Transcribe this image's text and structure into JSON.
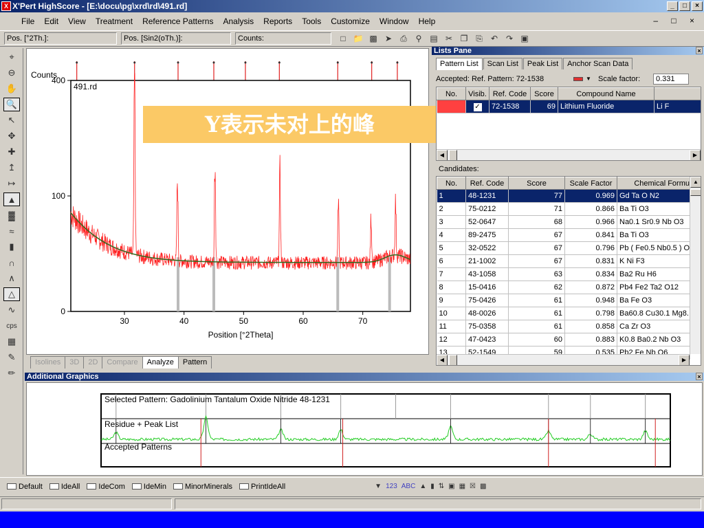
{
  "window": {
    "title": "X'Pert HighScore - [E:\\docu\\pg\\xrd\\rd\\491.rd]",
    "controls": [
      "_",
      "□",
      "×"
    ],
    "mdi_controls": "– □ ×"
  },
  "menu": [
    "File",
    "Edit",
    "View",
    "Treatment",
    "Reference Patterns",
    "Analysis",
    "Reports",
    "Tools",
    "Customize",
    "Window",
    "Help"
  ],
  "toolbar": {
    "pos_2th": "Pos. [°2Th.]:",
    "pos_sin": "Pos. [Sin2(oTh.)]:",
    "counts": "Counts:"
  },
  "plot": {
    "file_label": "491.rd",
    "ylabel": "Counts",
    "xlabel": "Position [°2Theta]",
    "overlay_text": "Y表示未对上的峰",
    "peak_markers_deg": [
      22,
      31.7,
      39,
      45,
      50.3,
      56,
      65.8,
      71.5,
      75.8
    ],
    "unmatched_bars_deg": [
      39,
      45,
      65.8,
      74.5
    ]
  },
  "chart_data": {
    "type": "line",
    "title": "491.rd",
    "xlabel": "Position [°2Theta]",
    "ylabel": "Counts",
    "xlim": [
      21,
      78
    ],
    "ylim": [
      0,
      400
    ],
    "y_scale": "sqrt",
    "xticks": [
      30,
      40,
      50,
      60,
      70
    ],
    "yticks": [
      0,
      100,
      400
    ],
    "series": [],
    "peaks": [
      {
        "x": 31.7,
        "y": 400
      },
      {
        "x": 38.9,
        "y": 130
      },
      {
        "x": 45.2,
        "y": 170
      },
      {
        "x": 56.1,
        "y": 145
      },
      {
        "x": 65.9,
        "y": 82
      },
      {
        "x": 71.4,
        "y": 70
      },
      {
        "x": 75.5,
        "y": 90
      }
    ]
  },
  "bottom_tabs": [
    "Isolines",
    "3D",
    "2D",
    "Compare",
    "Analyze",
    "Pattern"
  ],
  "lists_pane": {
    "title": "Lists Pane",
    "tabs": [
      "Pattern List",
      "Scan List",
      "Peak List",
      "Anchor Scan Data"
    ],
    "accepted_label": "Accepted: Ref. Pattern: 72-1538",
    "scale_label": "Scale factor:",
    "scale_value": "0.331",
    "accepted_headers": [
      "No.",
      "Visib.",
      "Ref. Code",
      "Score",
      "Compound Name",
      "Ch"
    ],
    "accepted_rows": [
      {
        "no": "",
        "ref": "72-1538",
        "score": "69",
        "name": "Lithium Fluoride",
        "ch": "Li F"
      }
    ],
    "candidates_label": "Candidates:",
    "cand_headers": [
      "No.",
      "Ref. Code",
      "Score",
      "Scale Factor",
      "Chemical Formu"
    ],
    "candidates": [
      {
        "no": "1",
        "ref": "48-1231",
        "score": "77",
        "sf": "0.969",
        "formula": "Gd Ta O N2"
      },
      {
        "no": "2",
        "ref": "75-0212",
        "score": "71",
        "sf": "0.866",
        "formula": "Ba Ti O3"
      },
      {
        "no": "3",
        "ref": "52-0647",
        "score": "68",
        "sf": "0.966",
        "formula": "Na0.1 Sr0.9 Nb O3"
      },
      {
        "no": "4",
        "ref": "89-2475",
        "score": "67",
        "sf": "0.841",
        "formula": "Ba Ti O3"
      },
      {
        "no": "5",
        "ref": "32-0522",
        "score": "67",
        "sf": "0.796",
        "formula": "Pb ( Fe0.5 Nb0.5 ) O"
      },
      {
        "no": "6",
        "ref": "21-1002",
        "score": "67",
        "sf": "0.831",
        "formula": "K Ni F3"
      },
      {
        "no": "7",
        "ref": "43-1058",
        "score": "63",
        "sf": "0.834",
        "formula": "Ba2 Ru H6"
      },
      {
        "no": "8",
        "ref": "15-0416",
        "score": "62",
        "sf": "0.872",
        "formula": "Pb4 Fe2 Ta2 O12"
      },
      {
        "no": "9",
        "ref": "75-0426",
        "score": "61",
        "sf": "0.948",
        "formula": "Ba Fe O3"
      },
      {
        "no": "10",
        "ref": "48-0026",
        "score": "61",
        "sf": "0.798",
        "formula": "Ba60.8 Cu30.1 Mg8."
      },
      {
        "no": "11",
        "ref": "75-0358",
        "score": "61",
        "sf": "0.858",
        "formula": "Ca Zr O3"
      },
      {
        "no": "12",
        "ref": "47-0423",
        "score": "60",
        "sf": "0.883",
        "formula": "K0.8 Ba0.2 Nb O3"
      },
      {
        "no": "13",
        "ref": "52-1549",
        "score": "59",
        "sf": "0.535",
        "formula": "Pb2 Fe Nb O6"
      }
    ]
  },
  "additional_graphics": {
    "title": "Additional Graphics",
    "selected": "Selected Pattern: Gadolinium Tantalum Oxide Nitride  48-1231",
    "residue": "Residue + Peak List",
    "accepted": "Accepted Patterns"
  },
  "status_buttons": [
    "Default",
    "IdeAll",
    "IdeCom",
    "IdeMin",
    "MinorMinerals",
    "PrintIdeAll"
  ],
  "status_right_icons": [
    "123",
    "ABC",
    "cps"
  ],
  "colors": {
    "accent": "#0a246a",
    "pattern": "#ff2020",
    "background_fit": "#2e6b1f",
    "residue": "#22cc22",
    "overlay": "#fbc966"
  }
}
